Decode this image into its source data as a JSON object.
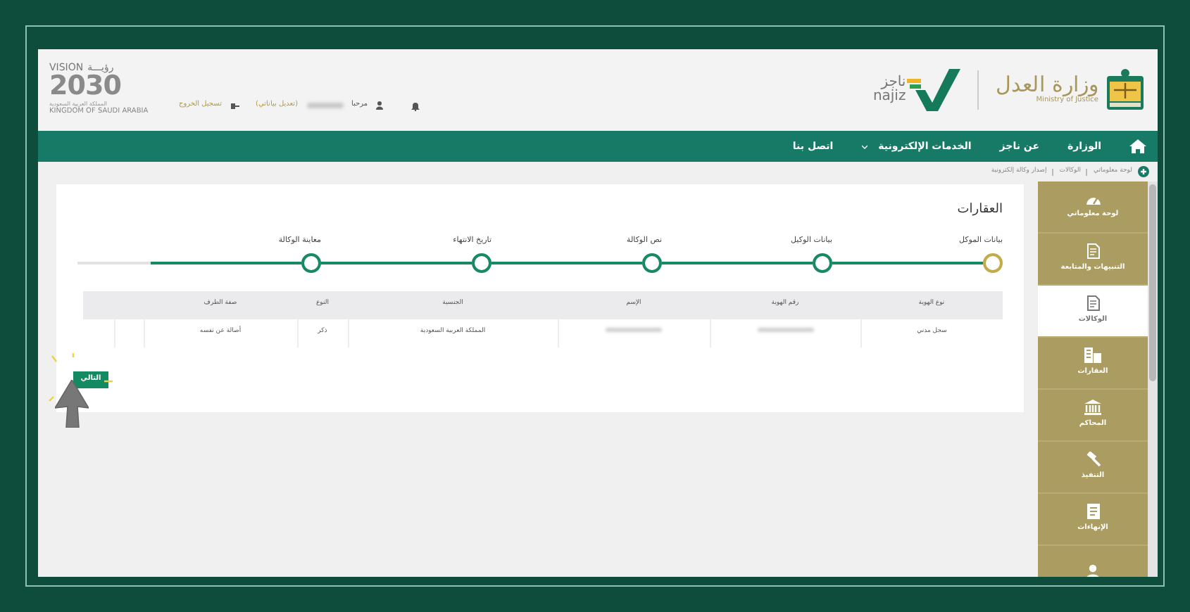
{
  "header": {
    "vision_logo": {
      "word": "VISION",
      "arabic_word": "رؤيـــة",
      "year": "2030",
      "country_ar": "المملكة العربية السعودية",
      "country_en": "KINGDOM OF SAUDI ARABIA"
    },
    "user_menu": {
      "greeting": "مرحبا",
      "name_hidden": true,
      "edit_profile": "(تعديل بياناتي)",
      "logout": "تسجيل الخروج"
    },
    "ministry_logo": {
      "title": "وزارة العدل",
      "subtitle": "Ministry of Justice"
    },
    "najiz_logo": {
      "arabic": "ناجز",
      "latin": "najiz"
    }
  },
  "nav": [
    {
      "label": "الوزارة",
      "dropdown": false
    },
    {
      "label": "عن ناجز",
      "dropdown": false
    },
    {
      "label": "الخدمات الإلكترونية",
      "dropdown": true
    },
    {
      "label": "اتصل بنا",
      "dropdown": false
    }
  ],
  "breadcrumb": [
    "لوحة معلوماتي",
    "الوكالات",
    "إصدار وكالة إلكترونية"
  ],
  "sidebar": [
    {
      "label": "لوحة معلوماتي",
      "kind": "dashboard",
      "selected": false
    },
    {
      "label": "التنبيهات والمتابعة",
      "kind": "doc",
      "selected": false
    },
    {
      "label": "الوكالات",
      "kind": "doc",
      "selected": true
    },
    {
      "label": "العقارات",
      "kind": "building",
      "selected": false
    },
    {
      "label": "المحاكم",
      "kind": "court",
      "selected": false
    },
    {
      "label": "التنفيذ",
      "kind": "gavel",
      "selected": false
    },
    {
      "label": "الإنهاءات",
      "kind": "page",
      "selected": false
    },
    {
      "kind": "person",
      "selected": false
    }
  ],
  "section_title": "العقارات",
  "steps": [
    {
      "label": "بيانات الموكل",
      "current": true
    },
    {
      "label": "بيانات الوكيل",
      "current": false
    },
    {
      "label": "نص الوكالة",
      "current": false
    },
    {
      "label": "تاريخ الانتهاء",
      "current": false
    },
    {
      "label": "معاينة الوكالة",
      "current": false
    }
  ],
  "table": {
    "columns": [
      "نوع الهوية",
      "رقم الهوية",
      "الإسم",
      "الجنسية",
      "النوع",
      "صفة الطرف"
    ],
    "rows": [
      {
        "cells": [
          {
            "kind": "text",
            "text": "سجل مدني"
          },
          {
            "kind": "blurred"
          },
          {
            "kind": "blurred"
          },
          {
            "kind": "text",
            "text": "المملكة العربية السعودية"
          },
          {
            "kind": "text",
            "text": "ذكر"
          },
          {
            "kind": "text",
            "text": "أصالة عن نفسه"
          }
        ]
      }
    ]
  },
  "next_button": "التالي"
}
